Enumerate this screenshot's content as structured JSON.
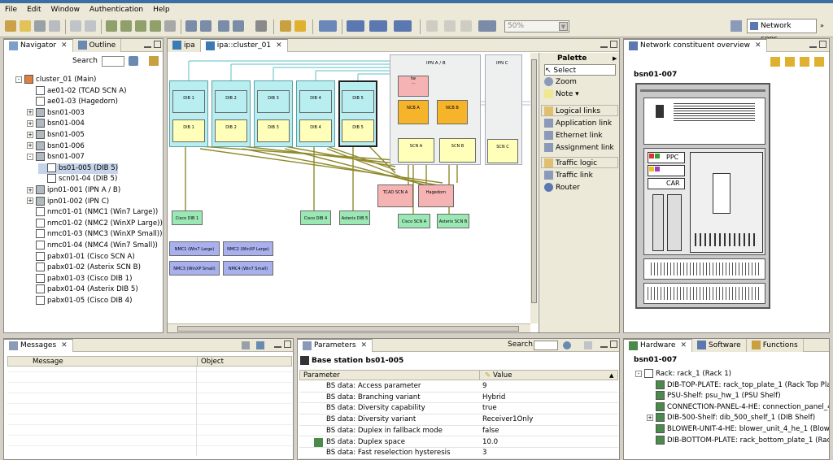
{
  "menu": [
    "File",
    "Edit",
    "Window",
    "Authentication",
    "Help"
  ],
  "toolbar": {
    "zoom_value": "50%",
    "perspective_label": "Network cons..."
  },
  "navigator": {
    "tabs": [
      "Navigator",
      "Outline"
    ],
    "search_label": "Search",
    "items": [
      {
        "label": "cluster_01 (Main)",
        "level": 0,
        "toggle": "-"
      },
      {
        "label": "ae01-02 (TCAD SCN A)",
        "level": 1,
        "toggle": ""
      },
      {
        "label": "ae01-03 (Hagedorn)",
        "level": 1,
        "toggle": ""
      },
      {
        "label": "bsn01-003",
        "level": 1,
        "toggle": "+"
      },
      {
        "label": "bsn01-004",
        "level": 1,
        "toggle": "+"
      },
      {
        "label": "bsn01-005",
        "level": 1,
        "toggle": "+"
      },
      {
        "label": "bsn01-006",
        "level": 1,
        "toggle": "+"
      },
      {
        "label": "bsn01-007",
        "level": 1,
        "toggle": "-"
      },
      {
        "label": "bs01-005 (DIB 5)",
        "level": 2,
        "toggle": "",
        "selected": true
      },
      {
        "label": "scn01-04 (DIB 5)",
        "level": 2,
        "toggle": ""
      },
      {
        "label": "ipn01-001 (IPN A / B)",
        "level": 1,
        "toggle": "+"
      },
      {
        "label": "ipn01-002 (IPN C)",
        "level": 1,
        "toggle": "+"
      },
      {
        "label": "nmc01-01 (NMC1 (Win7 Large))",
        "level": 1,
        "toggle": ""
      },
      {
        "label": "nmc01-02 (NMC2 (WinXP Large))",
        "level": 1,
        "toggle": ""
      },
      {
        "label": "nmc01-03 (NMC3 (WinXP Small))",
        "level": 1,
        "toggle": ""
      },
      {
        "label": "nmc01-04 (NMC4 (Win7 Small))",
        "level": 1,
        "toggle": ""
      },
      {
        "label": "pabx01-01 (Cisco SCN A)",
        "level": 1,
        "toggle": ""
      },
      {
        "label": "pabx01-02 (Asterix SCN B)",
        "level": 1,
        "toggle": ""
      },
      {
        "label": "pabx01-03 (Cisco DIB 1)",
        "level": 1,
        "toggle": ""
      },
      {
        "label": "pabx01-04 (Asterix DIB 5)",
        "level": 1,
        "toggle": ""
      },
      {
        "label": "pabx01-05 (Cisco DIB 4)",
        "level": 1,
        "toggle": ""
      }
    ]
  },
  "editor": {
    "tabs": [
      "ipa",
      "ipa::cluster_01"
    ],
    "palette_title": "Palette",
    "palette_tools": [
      "Select",
      "Zoom",
      "Note"
    ],
    "groups": [
      {
        "title": "Logical links",
        "items": [
          "Application link",
          "Ethernet link",
          "Assignment link"
        ]
      },
      {
        "title": "Traffic logic",
        "items": [
          "Traffic link",
          "Router"
        ]
      }
    ],
    "diagram_labels": {
      "ipn_ab": "IPN A / B",
      "ipn_c": "IPN C",
      "dib": [
        "DIB 1",
        "DIB 2",
        "DIB 3",
        "DIB 4",
        "DIB 5"
      ],
      "ncb": [
        "NCB A",
        "NCB B"
      ],
      "scn": [
        "SCN A",
        "SCN B",
        "SCN C"
      ],
      "tcad": "TCAD SCN A",
      "hagedorn": "Hagedorn",
      "pabx": [
        "Cisco DIB 1",
        "Cisco DIB 4",
        "Asterix DIB 5",
        "Cisco SCN A",
        "Asterix SCN B"
      ],
      "nmc": [
        "NMC1 (Win7 Large)",
        "NMC2 (WinXP Large)",
        "NMC3 (WinXP Small)",
        "NMC4 (Win7 Small)"
      ]
    }
  },
  "overview": {
    "tab": "Network constituent overview",
    "title": "bsn01-007",
    "labels": [
      "PPC",
      "CAR"
    ]
  },
  "messages": {
    "tab": "Messages",
    "columns": [
      "Message",
      "Object"
    ]
  },
  "parameters": {
    "tab": "Parameters",
    "search_label": "Search",
    "title": "Base station bs01-005",
    "columns": [
      "Parameter",
      "Value"
    ],
    "rows": [
      {
        "name": "BS data: Access parameter",
        "value": "9"
      },
      {
        "name": "BS data: Branching variant",
        "value": "Hybrid"
      },
      {
        "name": "BS data: Diversity capability",
        "value": "true"
      },
      {
        "name": "BS data: Diversity variant",
        "value": "Receiver1Only"
      },
      {
        "name": "BS data: Duplex in fallback mode",
        "value": "false"
      },
      {
        "name": "BS data: Duplex space",
        "value": "10.0"
      },
      {
        "name": "BS data: Fast reselection hysteresis",
        "value": "3"
      }
    ]
  },
  "hardware": {
    "tabs": [
      "Hardware",
      "Software",
      "Functions"
    ],
    "title": "bsn01-007",
    "items": [
      {
        "label": "Rack: rack_1 (Rack 1)",
        "level": 0,
        "toggle": "-"
      },
      {
        "label": "DIB-TOP-PLATE: rack_top_plate_1 (Rack Top Pla",
        "level": 1,
        "toggle": ""
      },
      {
        "label": "PSU-Shelf: psu_hw_1 (PSU Shelf)",
        "level": 1,
        "toggle": ""
      },
      {
        "label": "CONNECTION-PANEL-4-HE: connection_panel_4_",
        "level": 1,
        "toggle": ""
      },
      {
        "label": "DIB-500-Shelf: dib_500_shelf_1 (DIB Shelf)",
        "level": 1,
        "toggle": "+"
      },
      {
        "label": "BLOWER-UNIT-4-HE: blower_unit_4_he_1 (Blowe",
        "level": 1,
        "toggle": ""
      },
      {
        "label": "DIB-BOTTOM-PLATE: rack_bottom_plate_1 (Rack",
        "level": 1,
        "toggle": ""
      }
    ]
  },
  "colors": {
    "teal": "#b9eef0",
    "yellow": "#ffffb9",
    "orange": "#f5b429",
    "pink": "#f5b3b3",
    "green": "#9be8b5",
    "blue": "#a9b0ee"
  }
}
